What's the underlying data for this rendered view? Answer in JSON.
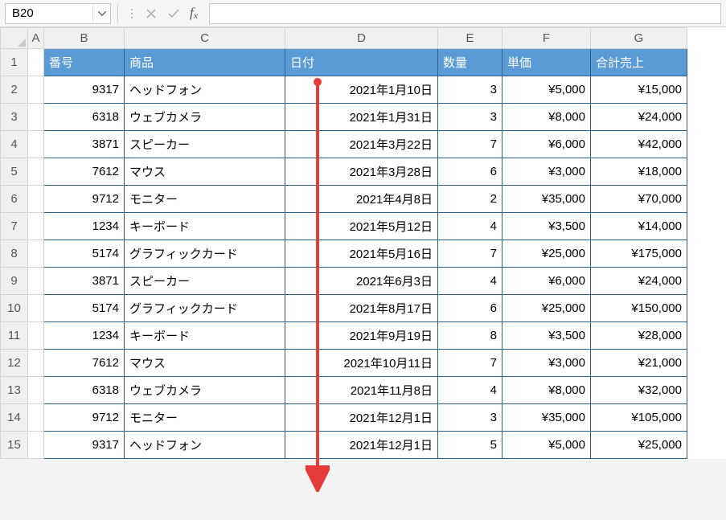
{
  "namebox": {
    "value": "B20"
  },
  "formula_bar": {
    "formula": ""
  },
  "column_headers": [
    "A",
    "B",
    "C",
    "D",
    "E",
    "F",
    "G"
  ],
  "row_headers": [
    1,
    2,
    3,
    4,
    5,
    6,
    7,
    8,
    9,
    10,
    11,
    12,
    13,
    14,
    15
  ],
  "table": {
    "headers": {
      "id": "番号",
      "product": "商品",
      "date": "日付",
      "qty": "数量",
      "unit_price": "単価",
      "total": "合計売上"
    },
    "rows": [
      {
        "id": "9317",
        "product": "ヘッドフォン",
        "date": "2021年1月10日",
        "qty": "3",
        "unit": "¥5,000",
        "total": "¥15,000"
      },
      {
        "id": "6318",
        "product": "ウェブカメラ",
        "date": "2021年1月31日",
        "qty": "3",
        "unit": "¥8,000",
        "total": "¥24,000"
      },
      {
        "id": "3871",
        "product": "スピーカー",
        "date": "2021年3月22日",
        "qty": "7",
        "unit": "¥6,000",
        "total": "¥42,000"
      },
      {
        "id": "7612",
        "product": "マウス",
        "date": "2021年3月28日",
        "qty": "6",
        "unit": "¥3,000",
        "total": "¥18,000"
      },
      {
        "id": "9712",
        "product": "モニター",
        "date": "2021年4月8日",
        "qty": "2",
        "unit": "¥35,000",
        "total": "¥70,000"
      },
      {
        "id": "1234",
        "product": "キーボード",
        "date": "2021年5月12日",
        "qty": "4",
        "unit": "¥3,500",
        "total": "¥14,000"
      },
      {
        "id": "5174",
        "product": "グラフィックカード",
        "date": "2021年5月16日",
        "qty": "7",
        "unit": "¥25,000",
        "total": "¥175,000"
      },
      {
        "id": "3871",
        "product": "スピーカー",
        "date": "2021年6月3日",
        "qty": "4",
        "unit": "¥6,000",
        "total": "¥24,000"
      },
      {
        "id": "5174",
        "product": "グラフィックカード",
        "date": "2021年8月17日",
        "qty": "6",
        "unit": "¥25,000",
        "total": "¥150,000"
      },
      {
        "id": "1234",
        "product": "キーボード",
        "date": "2021年9月19日",
        "qty": "8",
        "unit": "¥3,500",
        "total": "¥28,000"
      },
      {
        "id": "7612",
        "product": "マウス",
        "date": "2021年10月11日",
        "qty": "7",
        "unit": "¥3,000",
        "total": "¥21,000"
      },
      {
        "id": "6318",
        "product": "ウェブカメラ",
        "date": "2021年11月8日",
        "qty": "4",
        "unit": "¥8,000",
        "total": "¥32,000"
      },
      {
        "id": "9712",
        "product": "モニター",
        "date": "2021年12月1日",
        "qty": "3",
        "unit": "¥35,000",
        "total": "¥105,000"
      },
      {
        "id": "9317",
        "product": "ヘッドフォン",
        "date": "2021年12月1日",
        "qty": "5",
        "unit": "¥5,000",
        "total": "¥25,000"
      }
    ]
  },
  "annotation": {
    "arrow_color": "#e63b3b"
  }
}
